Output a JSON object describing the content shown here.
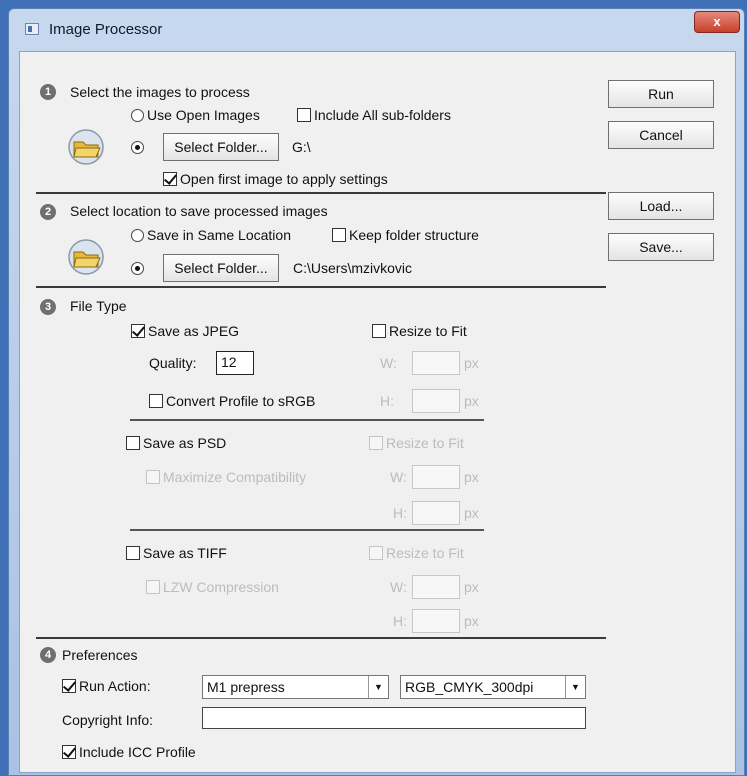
{
  "window": {
    "title": "Image Processor",
    "close_label": "x"
  },
  "section1": {
    "number": "1",
    "title": "Select the images to process",
    "use_open_images": "Use Open Images",
    "include_subfolders": "Include All sub-folders",
    "select_folder": "Select Folder...",
    "folder_path": "G:\\",
    "open_first_image": "Open first image to apply settings"
  },
  "section2": {
    "number": "2",
    "title": "Select location to save processed images",
    "same_location": "Save in Same Location",
    "keep_structure": "Keep folder structure",
    "select_folder": "Select Folder...",
    "folder_path": "C:\\Users\\mzivkovic"
  },
  "section3": {
    "number": "3",
    "title": "File Type",
    "jpeg": {
      "save_label": "Save as JPEG",
      "resize_label": "Resize to Fit",
      "quality_label": "Quality:",
      "quality_value": "12",
      "w_label": "W:",
      "h_label": "H:",
      "unit": "px",
      "convert_profile": "Convert Profile to sRGB"
    },
    "psd": {
      "save_label": "Save as PSD",
      "resize_label": "Resize to Fit",
      "maximize": "Maximize Compatibility",
      "w_label": "W:",
      "h_label": "H:",
      "unit": "px"
    },
    "tiff": {
      "save_label": "Save as TIFF",
      "resize_label": "Resize to Fit",
      "lzw": "LZW Compression",
      "w_label": "W:",
      "h_label": "H:",
      "unit": "px"
    }
  },
  "section4": {
    "number": "4",
    "title": "Preferences",
    "run_action_label": "Run Action:",
    "action_set": "M1 prepress",
    "action_name": "RGB_CMYK_300dpi",
    "copyright_label": "Copyright Info:",
    "copyright_value": "",
    "include_icc": "Include ICC Profile"
  },
  "buttons": {
    "run": "Run",
    "cancel": "Cancel",
    "load": "Load...",
    "save": "Save..."
  }
}
